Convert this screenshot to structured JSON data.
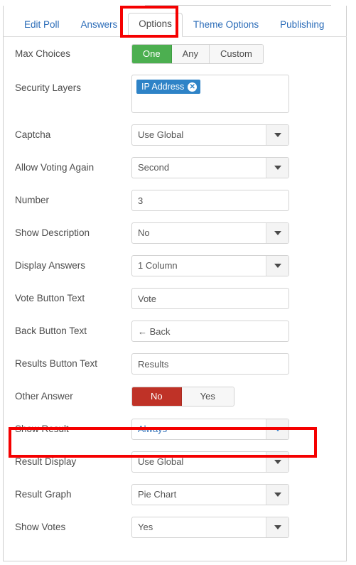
{
  "tabs": [
    {
      "label": "Edit Poll",
      "active": false
    },
    {
      "label": "Answers",
      "active": false
    },
    {
      "label": "Options",
      "active": true
    },
    {
      "label": "Theme Options",
      "active": false
    },
    {
      "label": "Publishing",
      "active": false
    }
  ],
  "colors": {
    "accent_green": "#4caf50",
    "accent_red": "#bf3227",
    "chip_blue": "#2e83c7",
    "link_blue": "#2b6cb8",
    "highlight_blue": "#3573b9",
    "annotation_red": "#f50000"
  },
  "form": {
    "max_choices": {
      "label": "Max Choices",
      "type": "buttongroup",
      "options": [
        "One",
        "Any",
        "Custom"
      ],
      "selected": "One"
    },
    "security_layers": {
      "label": "Security Layers",
      "type": "chips",
      "chips": [
        "IP Address"
      ],
      "remove_icon": "close-icon"
    },
    "captcha": {
      "label": "Captcha",
      "type": "select",
      "value": "Use Global"
    },
    "allow_voting_again": {
      "label": "Allow Voting Again",
      "type": "select",
      "value": "Second"
    },
    "number": {
      "label": "Number",
      "type": "text",
      "value": "3"
    },
    "show_description": {
      "label": "Show Description",
      "type": "select",
      "value": "No"
    },
    "display_answers": {
      "label": "Display Answers",
      "type": "select",
      "value": "1 Column"
    },
    "vote_button_text": {
      "label": "Vote Button Text",
      "type": "text",
      "value": "Vote"
    },
    "back_button_text": {
      "label": "Back Button Text",
      "type": "text",
      "value": "← Back"
    },
    "results_button_text": {
      "label": "Results Button Text",
      "type": "text",
      "value": "Results"
    },
    "other_answer": {
      "label": "Other Answer",
      "type": "buttongroup",
      "options": [
        "No",
        "Yes"
      ],
      "selected": "No"
    },
    "show_result": {
      "label": "Show Result",
      "type": "select",
      "value": "Always",
      "highlighted": true
    },
    "result_display": {
      "label": "Result Display",
      "type": "select",
      "value": "Use Global"
    },
    "result_graph": {
      "label": "Result Graph",
      "type": "select",
      "value": "Pie Chart"
    },
    "show_votes": {
      "label": "Show Votes",
      "type": "select",
      "value": "Yes"
    }
  },
  "annotations": [
    {
      "name": "options-tab-highlight",
      "target": "Options tab"
    },
    {
      "name": "show-result-row-highlight",
      "target": "Show Result row"
    }
  ]
}
